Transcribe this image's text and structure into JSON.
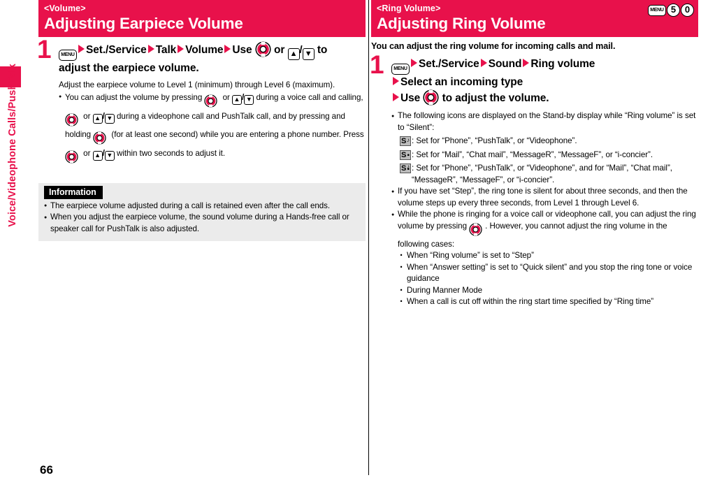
{
  "page": {
    "number": "66",
    "side_tab_label": "Voice/Videophone Calls/PushTalk",
    "accent_color": "#e8114b",
    "info_box_bg": "#ebebeb"
  },
  "left": {
    "banner": {
      "kicker": "<Volume>",
      "title": "Adjusting Earpiece Volume"
    },
    "step": {
      "number": "1",
      "head_line1_a": "Set./Service",
      "head_line1_b": "Talk",
      "head_line1_c": "Volume",
      "head_line1_d": "Use",
      "head_line1_or": "or",
      "head_line1_end": "to",
      "head_line2": "adjust the earpiece volume.",
      "keys": {
        "menu": "MENU",
        "up": "▲",
        "down": "▼",
        "slash": "/"
      }
    },
    "lead": "Adjust the earpiece volume to Level 1 (minimum) through Level 6 (maximum).",
    "bullet1": {
      "part1": "You can adjust the volume by pressing",
      "part2": "or",
      "part3": "during a voice call and calling,",
      "part4": "or",
      "part5": "during a videophone call and PushTalk call, and by pressing and holding",
      "part6": "(for at least one second) while you are entering a phone number. Press",
      "part7": "or",
      "part8": "within two seconds to adjust it."
    },
    "information": {
      "label": "Information",
      "items": [
        "The earpiece volume adjusted during a call is retained even after the call ends.",
        "When you adjust the earpiece volume, the sound volume during a Hands-free call or speaker call for PushTalk is also adjusted."
      ]
    }
  },
  "right": {
    "banner": {
      "kicker": "<Ring Volume>",
      "title": "Adjusting Ring Volume",
      "keys": [
        "MENU",
        "5",
        "0"
      ]
    },
    "intro": "You can adjust the ring volume for incoming calls and mail.",
    "step": {
      "number": "1",
      "head_line1_a": "Set./Service",
      "head_line1_b": "Sound",
      "head_line1_c": "Ring volume",
      "head_line2": "Select an incoming type",
      "head_line3_a": "Use",
      "head_line3_b": "to adjust the volume.",
      "keys": {
        "menu": "MENU"
      }
    },
    "bullets": {
      "icons_intro": "The following icons are displayed on the Stand-by display while “Ring volume” is set to “Silent”:",
      "icon_rows": [
        {
          "letter": "S",
          "mark_top": "♪",
          "mark_bottom": "",
          "text": ": Set for “Phone”, “PushTalk”, or “Videophone”."
        },
        {
          "letter": "S",
          "mark_top": "",
          "mark_bottom": "▪",
          "text": ": Set for “Mail”, “Chat mail”, “MessageR”, “MessageF”, or “i-concier”."
        },
        {
          "letter": "S",
          "mark_top": "♪",
          "mark_bottom": "▪",
          "text": ": Set for “Phone”, “PushTalk”, or “Videophone”, and for “Mail”, “Chat mail”, “MessageR”, “MessageF”, or “i-concier”."
        }
      ],
      "step_note": "If you have set “Step”, the ring tone is silent for about three seconds, and then the volume steps up every three seconds, from Level 1 through Level 6.",
      "ringing_note_a": "While the phone is ringing for a voice call or videophone call, you can adjust the ring volume by pressing",
      "ringing_note_b": ". However, you cannot adjust the ring volume in the following cases:",
      "cases": [
        "When “Ring volume” is set to “Step”",
        "When “Answer setting” is set to “Quick silent” and you stop the ring tone or voice guidance",
        "During Manner Mode",
        "When a call is cut off within the ring start time specified by “Ring time”"
      ]
    }
  }
}
